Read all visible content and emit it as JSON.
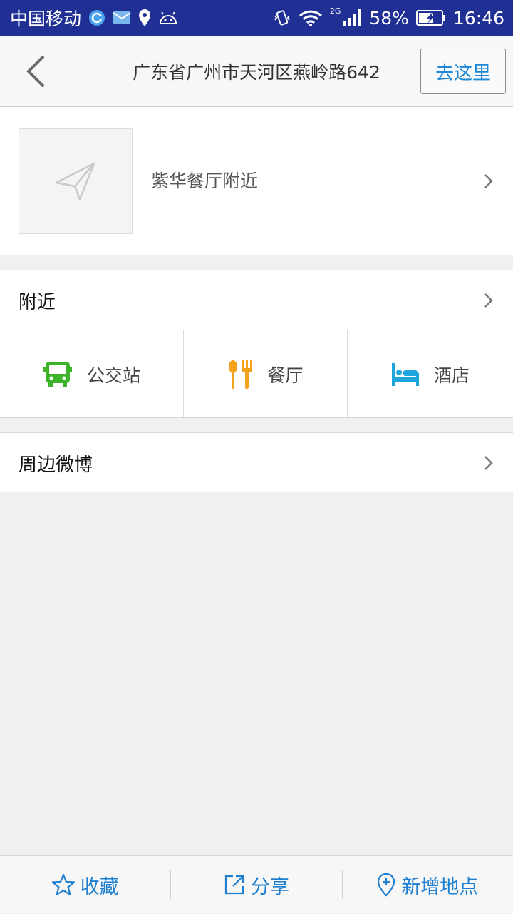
{
  "status_bar": {
    "carrier": "中国移动",
    "network": "2G",
    "battery": "58%",
    "time": "16:46",
    "icons": [
      "sync-icon",
      "mail-icon",
      "location-icon",
      "android-icon",
      "vibrate-icon",
      "wifi-icon",
      "signal-icon",
      "battery-icon"
    ]
  },
  "nav": {
    "title": "广东省广州市天河区燕岭路642",
    "go_label": "去这里",
    "accent_color": "#1e88d8"
  },
  "place": {
    "name": "紫华餐厅附近",
    "thumbnail_icon": "paper-plane-icon"
  },
  "nearby": {
    "title": "附近",
    "categories": [
      {
        "label": "公交站",
        "icon": "bus-icon",
        "color": "#3db32a"
      },
      {
        "label": "餐厅",
        "icon": "fork-spoon-icon",
        "color": "#f5a21b"
      },
      {
        "label": "酒店",
        "icon": "bed-icon",
        "color": "#1ea6dc"
      }
    ]
  },
  "weibo": {
    "title": "周边微博"
  },
  "bottom_bar": {
    "favorite_label": "收藏",
    "share_label": "分享",
    "add_place_label": "新增地点",
    "color": "#1e7fd0"
  }
}
